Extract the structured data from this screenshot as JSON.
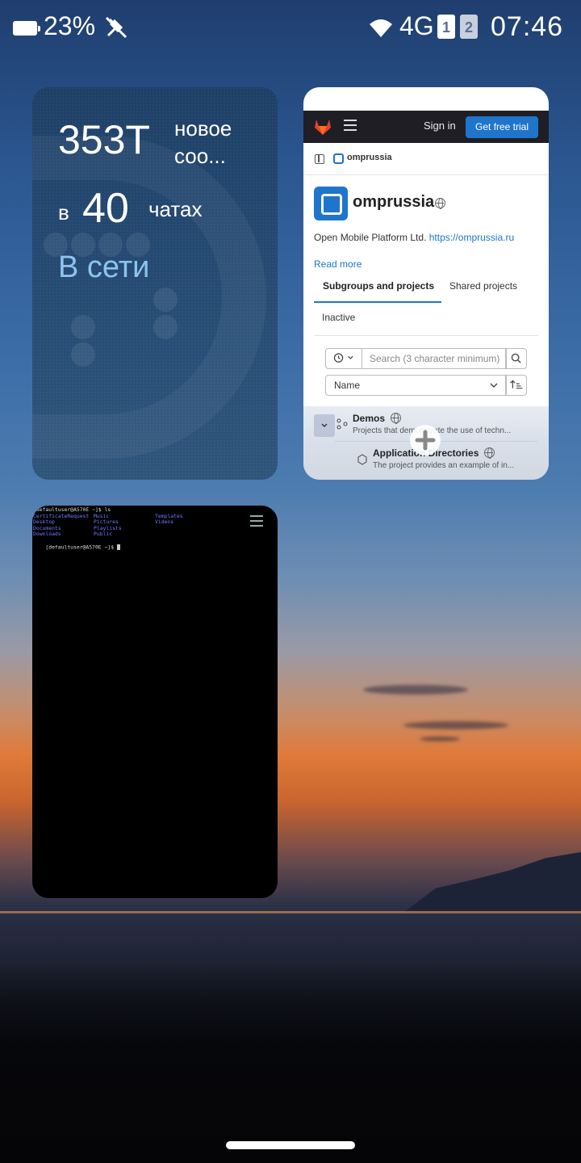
{
  "status_bar": {
    "battery_percent": "23%",
    "network_type": "4G",
    "sim1_label": "1",
    "sim2_label": "2",
    "time": "07:46"
  },
  "messenger_card": {
    "message_count": "353T",
    "new_messages_label": "новое соо...",
    "in_label": "в",
    "chat_count": "40",
    "chats_label": "чатах",
    "status": "В сети"
  },
  "browser_card": {
    "header": {
      "sign_in": "Sign in",
      "trial_button": "Get free trial"
    },
    "breadcrumb": "omprussia",
    "group_name": "omprussia",
    "description_text": "Open Mobile Platform Ltd.",
    "description_link": "https://omprussia.ru",
    "read_more": "Read more",
    "tabs": {
      "subgroups": "Subgroups and projects",
      "shared": "Shared projects",
      "inactive": "Inactive"
    },
    "search_placeholder": "Search (3 character minimum)",
    "sort_value": "Name",
    "items": [
      {
        "title": "Demos",
        "description": "Projects that demonstrate the use of techn..."
      },
      {
        "title": "Application Directories",
        "description": "The project provides an example of in..."
      }
    ],
    "accent_color": "#1f75cb"
  },
  "terminal_card": {
    "prompt_line": "[defaultuser@A570E ~]$ ls",
    "columns": [
      [
        "CertificateRequest",
        "Desktop",
        "Documents",
        "Downloads"
      ],
      [
        "Music",
        "Pictures",
        "Playlists",
        "Public"
      ],
      [
        "Templates",
        "Videos"
      ]
    ],
    "final_prompt": "[defaultuser@A570E ~]$ "
  }
}
